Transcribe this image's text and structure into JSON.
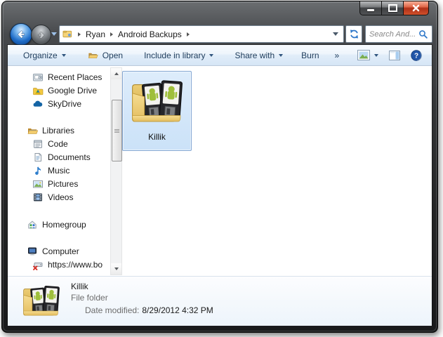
{
  "window": {
    "title": "",
    "controls": {
      "minimize_icon": "minimize-icon",
      "maximize_icon": "maximize-icon",
      "close_icon": "close-icon"
    }
  },
  "navigation": {
    "back_icon": "arrow-left-icon",
    "forward_icon": "arrow-right-icon",
    "breadcrumb": {
      "root_icon": "user-folder-icon",
      "items": [
        "Ryan",
        "Android Backups"
      ]
    },
    "refresh_icon": "refresh-icon",
    "search": {
      "placeholder": "Search And...",
      "icon": "magnifier-icon"
    }
  },
  "toolbar": {
    "organize": "Organize",
    "open": "Open",
    "include": "Include in library",
    "share": "Share with",
    "burn": "Burn",
    "overflow": "»",
    "views_icon": "views-icon",
    "preview_icon": "preview-pane-icon",
    "help_icon": "help-icon"
  },
  "sidebar": {
    "items": [
      {
        "label": "Recent Places",
        "icon": "recent-places-icon"
      },
      {
        "label": "Google Drive",
        "icon": "google-drive-icon"
      },
      {
        "label": "SkyDrive",
        "icon": "skydrive-cloud-icon"
      },
      {
        "label": "Libraries",
        "icon": "libraries-icon"
      },
      {
        "label": "Code",
        "icon": "library-icon"
      },
      {
        "label": "Documents",
        "icon": "document-icon"
      },
      {
        "label": "Music",
        "icon": "music-note-icon"
      },
      {
        "label": "Pictures",
        "icon": "picture-icon"
      },
      {
        "label": "Videos",
        "icon": "film-icon"
      },
      {
        "label": "Homegroup",
        "icon": "homegroup-icon"
      },
      {
        "label": "Computer",
        "icon": "computer-icon"
      },
      {
        "label": "https://www.bo",
        "icon": "disconnected-drive-icon"
      }
    ]
  },
  "main": {
    "selected_folder": {
      "label": "Killik",
      "icon": "folder-with-floppy-disks-icon",
      "selected": true
    }
  },
  "details_pane": {
    "name": "Killik",
    "type": "File folder",
    "date_modified_label": "Date modified:",
    "date_modified_value": "8/29/2012 4:32 PM",
    "icon": "folder-with-floppy-disks-icon"
  },
  "colors": {
    "toolbar_text": "#1e3c5b",
    "selection_border": "#84a7d3",
    "selection_fill": "#cbe2f8",
    "close_button_red": "#b03118",
    "accent_blue": "#2e77c9",
    "frame_dark": "#232425"
  }
}
